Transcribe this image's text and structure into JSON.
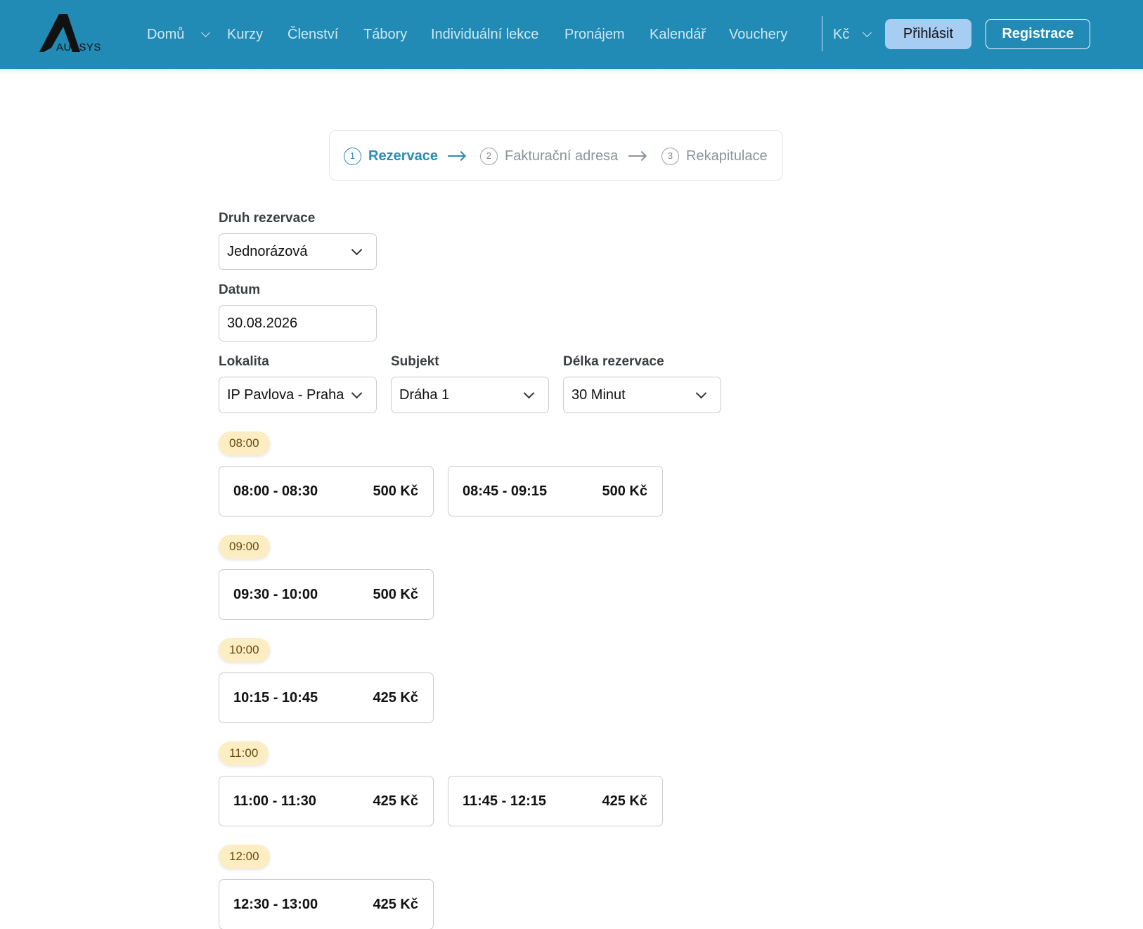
{
  "brand": {
    "name": "AUKSYS"
  },
  "nav": {
    "items": [
      {
        "label": "Domů"
      },
      {
        "label": "Kurzy"
      },
      {
        "label": "Členství"
      },
      {
        "label": "Tábory"
      },
      {
        "label": "Individuální lekce"
      },
      {
        "label": "Pronájem"
      },
      {
        "label": "Kalendář"
      },
      {
        "label": "Vouchery"
      }
    ],
    "currency": "Kč",
    "login": "Přihlásit",
    "register": "Registrace"
  },
  "stepper": {
    "steps": [
      {
        "number": "1",
        "label": "Rezervace",
        "active": true
      },
      {
        "number": "2",
        "label": "Fakturační adresa",
        "active": false
      },
      {
        "number": "3",
        "label": "Rekapitulace",
        "active": false
      }
    ]
  },
  "form": {
    "type": {
      "label": "Druh rezervace",
      "value": "Jednorázová"
    },
    "date": {
      "label": "Datum",
      "value": "30.08.2026"
    },
    "location": {
      "label": "Lokalita",
      "value": "IP Pavlova - Praha"
    },
    "subject": {
      "label": "Subjekt",
      "value": "Dráha 1"
    },
    "length": {
      "label": "Délka rezervace",
      "value": "30 Minut"
    }
  },
  "groups": [
    {
      "hour": "08:00",
      "slots": [
        {
          "time": "08:00 - 08:30",
          "price": "500 Kč"
        },
        {
          "time": "08:45 - 09:15",
          "price": "500 Kč"
        }
      ]
    },
    {
      "hour": "09:00",
      "slots": [
        {
          "time": "09:30 - 10:00",
          "price": "500 Kč"
        }
      ]
    },
    {
      "hour": "10:00",
      "slots": [
        {
          "time": "10:15 - 10:45",
          "price": "425 Kč"
        }
      ]
    },
    {
      "hour": "11:00",
      "slots": [
        {
          "time": "11:00 - 11:30",
          "price": "425 Kč"
        },
        {
          "time": "11:45 - 12:15",
          "price": "425 Kč"
        }
      ]
    },
    {
      "hour": "12:00",
      "slots": [
        {
          "time": "12:30 - 13:00",
          "price": "425 Kč"
        }
      ]
    }
  ],
  "colors": {
    "header": "#218ab5",
    "accent": "#2b8cb8",
    "badge": "#fcedc2",
    "login_button": "#a7cdf3"
  }
}
